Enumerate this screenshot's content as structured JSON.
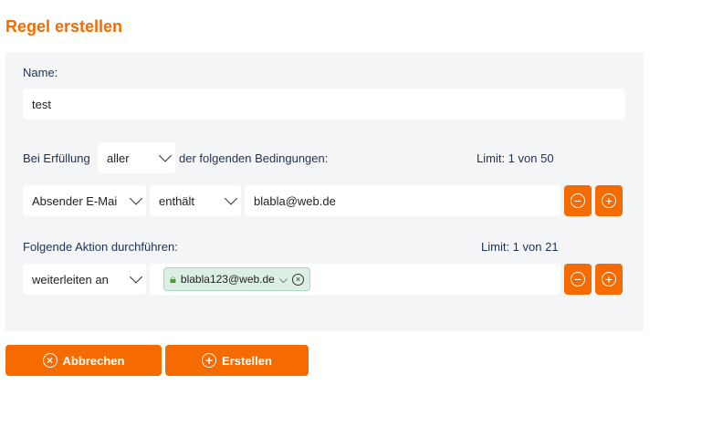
{
  "title": "Regel erstellen",
  "name_label": "Name:",
  "name_value": "test",
  "conditions": {
    "prefix": "Bei Erfüllung",
    "match_value": "aller",
    "suffix": "der folgenden Bedingungen:",
    "limit": "Limit: 1 von 50",
    "field": "Absender E-Mai",
    "operator": "enthält",
    "value": "blabla@web.de"
  },
  "action": {
    "label": "Folgende Aktion durchführen:",
    "limit": "Limit: 1 von 21",
    "type": "weiterleiten an",
    "recipient": "blabla123@web.de"
  },
  "buttons": {
    "cancel": "Abbrechen",
    "create": "Erstellen"
  },
  "colors": {
    "accent": "#f56b00"
  }
}
